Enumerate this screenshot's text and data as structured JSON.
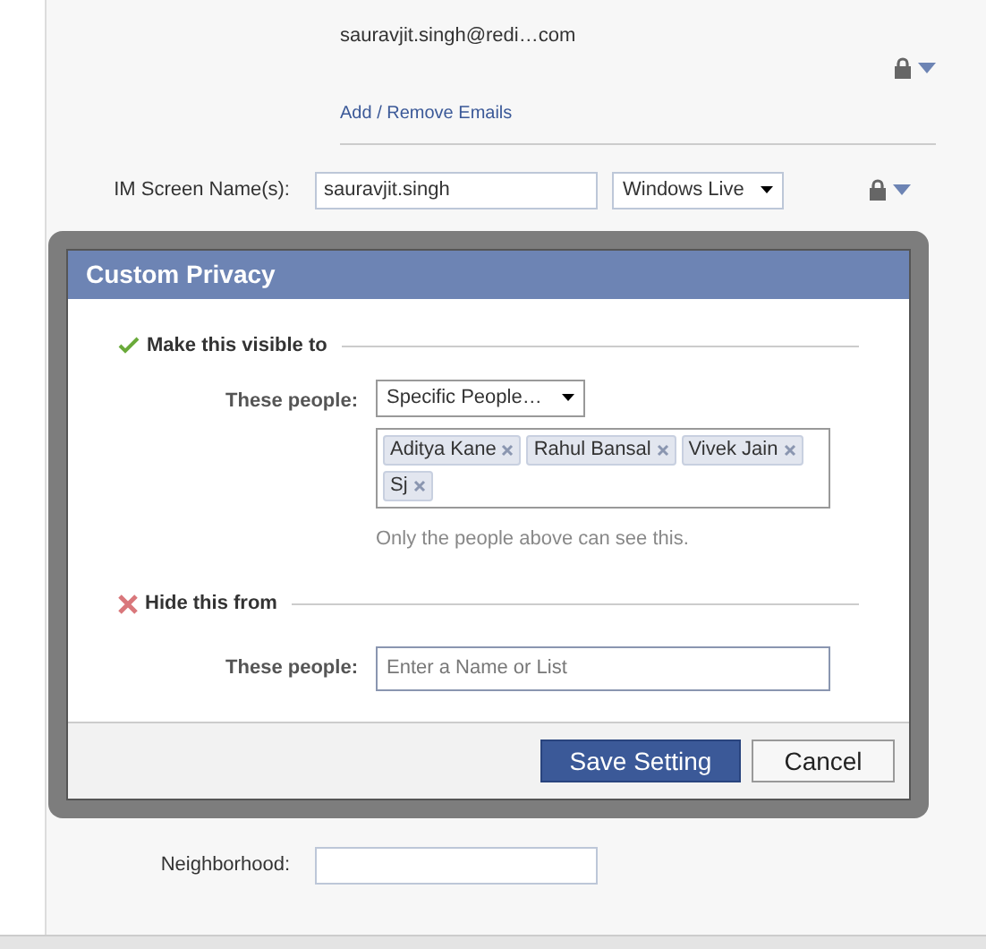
{
  "email": {
    "address": "sauravjit.singh@redi…com",
    "link": "Add / Remove Emails"
  },
  "im": {
    "label": "IM Screen Name(s):",
    "value": "sauravjit.singh",
    "service": "Windows Live"
  },
  "neighborhood": {
    "label": "Neighborhood:"
  },
  "dialog": {
    "title": "Custom Privacy",
    "show": {
      "heading": "Make this visible to",
      "label": "These people:",
      "choice": "Specific People…",
      "people": [
        "Aditya Kane",
        "Rahul Bansal",
        "Vivek Jain",
        "Sj"
      ],
      "note": "Only the people above can see this."
    },
    "hide": {
      "heading": "Hide this from",
      "label": "These people:",
      "placeholder": "Enter a Name or List"
    },
    "buttons": [
      {
        "label": "Save Setting",
        "kind": "primary"
      },
      {
        "label": "Cancel",
        "kind": "secondary"
      }
    ]
  }
}
